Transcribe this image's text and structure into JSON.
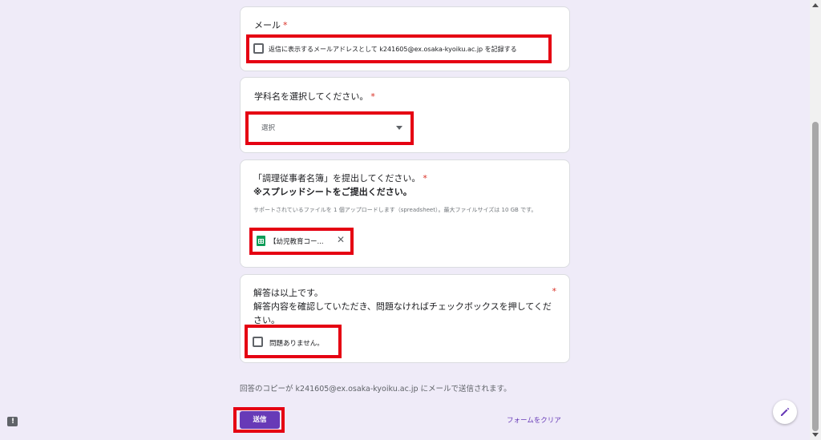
{
  "email_question": {
    "title": "メール",
    "required_mark": "*",
    "checkbox_label": "返信に表示するメールアドレスとして k241605@ex.osaka-kyoiku.ac.jp を記録する"
  },
  "department_question": {
    "title": "学科名を選択してください。",
    "required_mark": "*",
    "select_value": "選択"
  },
  "upload_question": {
    "title_line1": "「調理従事者名簿」を提出してください。",
    "required_mark": "*",
    "title_line2": "※スプレッドシートをご提出ください。",
    "hint": "サポートされているファイルを 1 個アップロードします（spreadsheet）。最大ファイルサイズは 10 GB です。",
    "file_name": "【幼児教育コー..."
  },
  "confirm_question": {
    "line1": "解答は以上です。",
    "line2": "解答内容を確認していただき、問題なければチェックボックスを押してください。",
    "required_mark": "*",
    "checkbox_label": "問題ありません。"
  },
  "footer": {
    "copy_notice": "回答のコピーが k241605@ex.osaka-kyoiku.ac.jp にメールで送信されます。",
    "submit_label": "送信",
    "clear_label": "フォームをクリア"
  },
  "colors": {
    "accent": "#673ab7",
    "highlight": "#e50012",
    "required": "#d93025",
    "background": "#efebf8"
  },
  "icons": {
    "sheets": "google-sheets-icon",
    "close": "close-icon",
    "dropdown": "caret-down-icon",
    "edit": "pencil-icon",
    "feedback": "report-issue-icon"
  }
}
